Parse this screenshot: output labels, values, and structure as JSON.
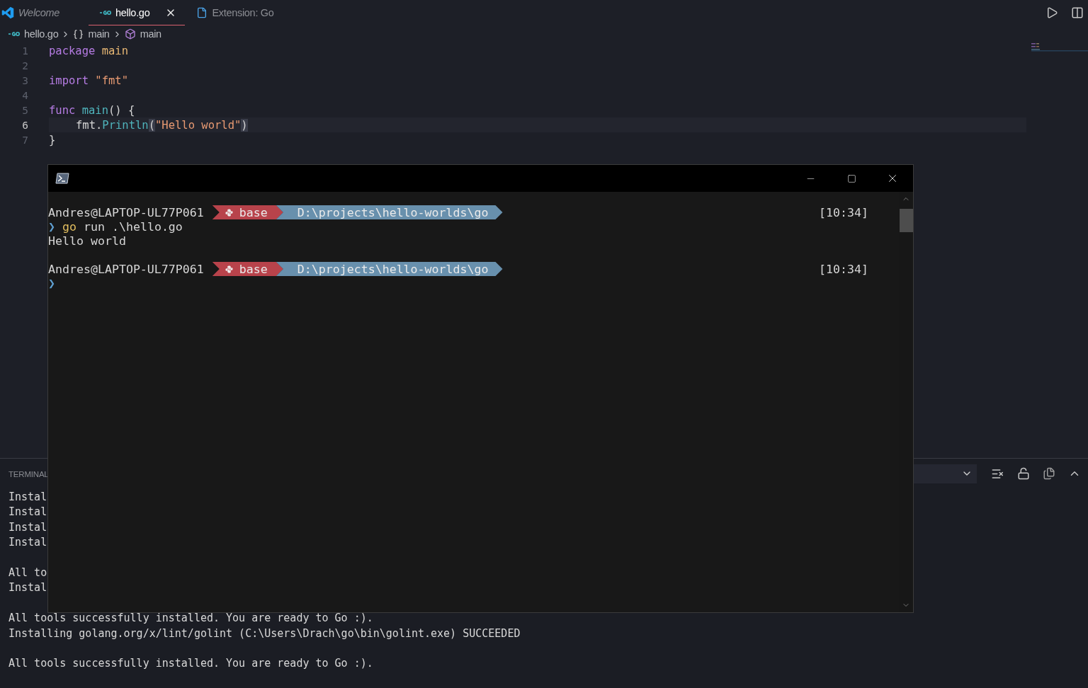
{
  "editor_tabs": [
    {
      "label": "Welcome",
      "kind": "welcome",
      "preview": true,
      "selected": false
    },
    {
      "label": "hello.go",
      "kind": "go",
      "preview": false,
      "selected": true
    },
    {
      "label": "Extension: Go",
      "kind": "document",
      "preview": false,
      "selected": false
    }
  ],
  "breadcrumb": [
    {
      "label": "hello.go",
      "kind": "go"
    },
    {
      "label": "main",
      "kind": "package"
    },
    {
      "label": "main",
      "kind": "function"
    }
  ],
  "code_lines": [
    {
      "number": "1",
      "current": false,
      "indented": false,
      "tokens": [
        {
          "text": "package ",
          "kind": "keyword"
        },
        {
          "text": "main",
          "kind": "name"
        }
      ]
    },
    {
      "number": "2",
      "current": false
    },
    {
      "number": "3",
      "current": false,
      "indented": false,
      "tokens": [
        {
          "text": "import ",
          "kind": "keyword"
        },
        {
          "text": "\"fmt\"",
          "kind": "string"
        }
      ]
    },
    {
      "number": "4",
      "current": false
    },
    {
      "number": "5",
      "current": false,
      "indented": false,
      "tokens": [
        {
          "text": "func ",
          "kind": "keyword"
        },
        {
          "text": "main",
          "kind": "function"
        },
        {
          "text": "() {",
          "kind": "plain"
        }
      ]
    },
    {
      "number": "6",
      "current": true,
      "indented": true,
      "tokens": [
        {
          "text": "fmt.",
          "kind": "plain"
        },
        {
          "text": "Println",
          "kind": "function"
        },
        {
          "text": "(",
          "kind": "bracket"
        },
        {
          "text": "\"Hello world\"",
          "kind": "string"
        },
        {
          "text": ")",
          "kind": "bracket"
        }
      ]
    },
    {
      "number": "7",
      "current": false,
      "indented": false,
      "tokens": [
        {
          "text": "}",
          "kind": "plain"
        }
      ]
    }
  ],
  "panel": {
    "tabs": [
      {
        "label": "TERMINAL",
        "selected": false
      }
    ],
    "output_lines": [
      {
        "kind": "text",
        "text": "Instal"
      },
      {
        "kind": "text",
        "text": "Instal"
      },
      {
        "kind": "text",
        "text": "Instal"
      },
      {
        "kind": "text",
        "text": "Instal"
      },
      {
        "kind": "blank"
      },
      {
        "kind": "text",
        "text": "All to"
      },
      {
        "kind": "text",
        "text": "Instal"
      },
      {
        "kind": "blank"
      },
      {
        "kind": "text",
        "text": "All tools successfully installed. You are ready to Go :)."
      },
      {
        "kind": "text",
        "text": "Installing golang.org/x/lint/golint (C:\\Users\\Drach\\go\\bin\\golint.exe) SUCCEEDED"
      },
      {
        "kind": "blank"
      },
      {
        "kind": "text",
        "text": "All tools successfully installed. You are ready to Go :)."
      }
    ]
  },
  "terminal_window": {
    "lines": [
      {
        "kind": "prompt",
        "user": "Andres@LAPTOP-UL77P061",
        "env": "base",
        "path": "D:\\projects\\hello-worlds\\go",
        "time": "[10:34]"
      },
      {
        "kind": "input",
        "symbol": "❯",
        "program": "go",
        "args": "run .\\hello.go"
      },
      {
        "kind": "output",
        "text": "Hello world"
      },
      {
        "kind": "blank"
      },
      {
        "kind": "prompt",
        "user": "Andres@LAPTOP-UL77P061",
        "env": "base",
        "path": "D:\\projects\\hello-worlds\\go",
        "time": "[10:34]"
      },
      {
        "kind": "input",
        "symbol": "❯"
      }
    ]
  }
}
